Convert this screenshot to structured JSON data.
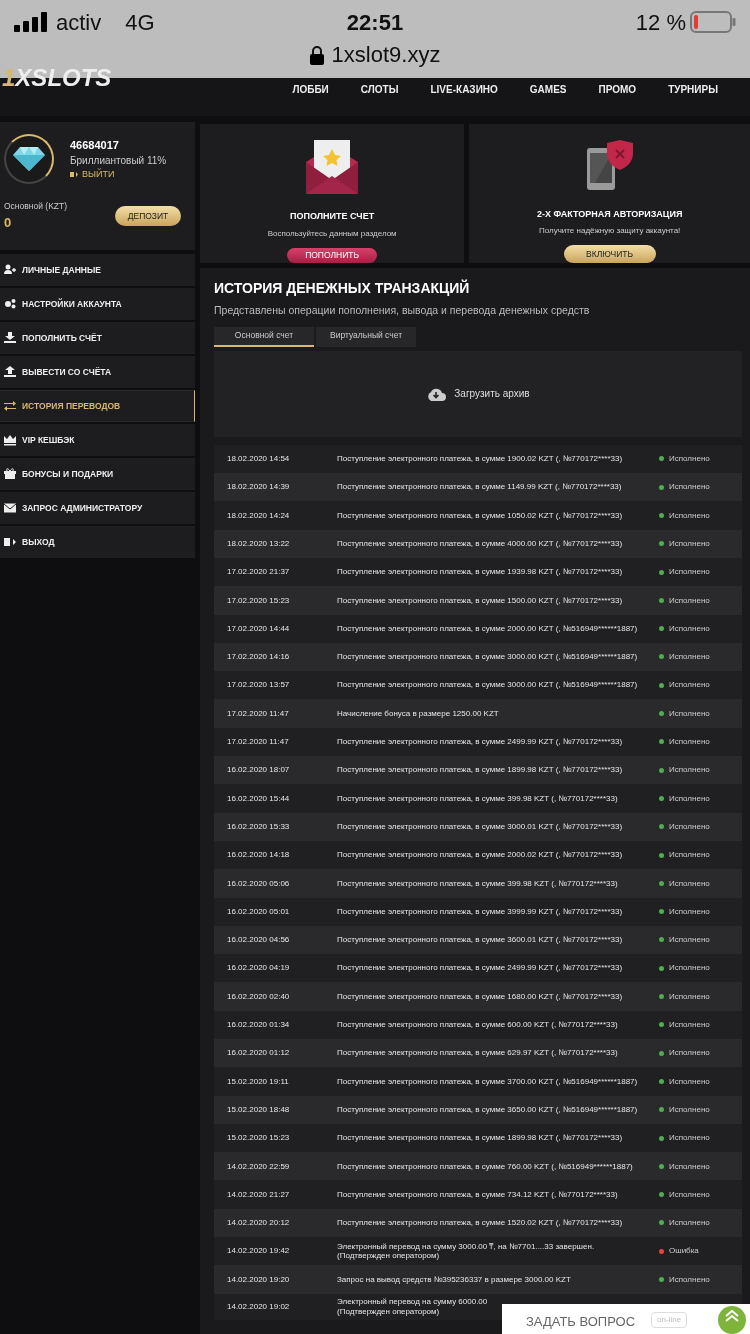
{
  "status_bar": {
    "carrier": "activ",
    "network": "4G",
    "time": "22:51",
    "battery": "12 %",
    "url": "1xslot9.xyz"
  },
  "header": {
    "logo": "1XSLOTS",
    "nav": [
      "ЛОББИ",
      "СЛОТЫ",
      "LIVE-КАЗИНО",
      "GAMES",
      "ПРОМО",
      "ТУРНИРЫ"
    ]
  },
  "profile": {
    "account_id": "46684017",
    "level": "Бриллиантовый 11%",
    "logout": "ВЫЙТИ",
    "balance_label": "Основной (KZT)",
    "balance": "0",
    "deposit_button": "ДЕПОЗИТ"
  },
  "sidebar": {
    "items": [
      {
        "label": "ЛИЧНЫЕ ДАННЫЕ",
        "selected": false
      },
      {
        "label": "НАСТРОЙКИ АККАУНТА",
        "selected": false
      },
      {
        "label": "ПОПОЛНИТЬ СЧЁТ",
        "selected": false
      },
      {
        "label": "ВЫВЕСТИ СО СЧЁТА",
        "selected": false
      },
      {
        "label": "ИСТОРИЯ ПЕРЕВОДОВ",
        "selected": true
      },
      {
        "label": "VIP КЕШБЭК",
        "selected": false
      },
      {
        "label": "БОНУСЫ И ПОДАРКИ",
        "selected": false
      },
      {
        "label": "ЗАПРОС АДМИНИСТРАТОРУ",
        "selected": false
      },
      {
        "label": "ВЫХОД",
        "selected": false
      }
    ]
  },
  "promo_cards": [
    {
      "kind": "envelope",
      "title": "ПОПОЛНИТЕ СЧЕТ",
      "text": "Воспользуйтесь данным разделом",
      "button": "ПОПОЛНИТЬ"
    },
    {
      "kind": "phone",
      "title": "2-Х ФАКТОРНАЯ АВТОРИЗАЦИЯ",
      "text": "Получите надёжную защиту аккаунта!",
      "button": "ВКЛЮЧИТЬ"
    }
  ],
  "history": {
    "title": "ИСТОРИЯ ДЕНЕЖНЫХ ТРАНЗАКЦИЙ",
    "subtitle": "Представлены операции пополнения, вывода и перевода денежных средств",
    "tabs": [
      {
        "label": "Основной счет",
        "selected": true
      },
      {
        "label": "Виртуальный счет",
        "selected": false
      }
    ],
    "archive_button": "Загрузить архив",
    "rows": [
      {
        "date": "18.02.2020 14:54",
        "text": "Поступление электронного платежа, в сумме 1900.02 KZT (, №770172****33)",
        "status": "Исполнено",
        "color": "#4caf50"
      },
      {
        "date": "18.02.2020 14:39",
        "text": "Поступление электронного платежа, в сумме 1149.99 KZT (, №770172****33)",
        "status": "Исполнено",
        "color": "#4caf50"
      },
      {
        "date": "18.02.2020 14:24",
        "text": "Поступление электронного платежа, в сумме 1050.02 KZT (, №770172****33)",
        "status": "Исполнено",
        "color": "#4caf50"
      },
      {
        "date": "18.02.2020 13:22",
        "text": "Поступление электронного платежа, в сумме 4000.00 KZT (, №770172****33)",
        "status": "Исполнено",
        "color": "#4caf50"
      },
      {
        "date": "17.02.2020 21:37",
        "text": "Поступление электронного платежа, в сумме 1939.98 KZT (, №770172****33)",
        "status": "Исполнено",
        "color": "#4caf50"
      },
      {
        "date": "17.02.2020 15:23",
        "text": "Поступление электронного платежа, в сумме 1500.00 KZT (, №770172****33)",
        "status": "Исполнено",
        "color": "#4caf50"
      },
      {
        "date": "17.02.2020 14:44",
        "text": "Поступление электронного платежа, в сумме 2000.00 KZT (, №516949******1887)",
        "status": "Исполнено",
        "color": "#4caf50"
      },
      {
        "date": "17.02.2020 14:16",
        "text": "Поступление электронного платежа, в сумме 3000.00 KZT (, №516949******1887)",
        "status": "Исполнено",
        "color": "#4caf50"
      },
      {
        "date": "17.02.2020 13:57",
        "text": "Поступление электронного платежа, в сумме 3000.00 KZT (, №516949******1887)",
        "status": "Исполнено",
        "color": "#4caf50"
      },
      {
        "date": "17.02.2020 11:47",
        "text": "Начисление бонуса в размере 1250.00 KZT",
        "status": "Исполнено",
        "color": "#4caf50"
      },
      {
        "date": "17.02.2020 11:47",
        "text": "Поступление электронного платежа, в сумме 2499.99 KZT (, №770172****33)",
        "status": "Исполнено",
        "color": "#4caf50"
      },
      {
        "date": "16.02.2020 18:07",
        "text": "Поступление электронного платежа, в сумме 1899.98 KZT (, №770172****33)",
        "status": "Исполнено",
        "color": "#4caf50"
      },
      {
        "date": "16.02.2020 15:44",
        "text": "Поступление электронного платежа, в сумме 399.98 KZT (, №770172****33)",
        "status": "Исполнено",
        "color": "#4caf50"
      },
      {
        "date": "16.02.2020 15:33",
        "text": "Поступление электронного платежа, в сумме 3000.01 KZT (, №770172****33)",
        "status": "Исполнено",
        "color": "#4caf50"
      },
      {
        "date": "16.02.2020 14:18",
        "text": "Поступление электронного платежа, в сумме 2000.02 KZT (, №770172****33)",
        "status": "Исполнено",
        "color": "#4caf50"
      },
      {
        "date": "16.02.2020 05:06",
        "text": "Поступление электронного платежа, в сумме 399.98 KZT (, №770172****33)",
        "status": "Исполнено",
        "color": "#4caf50"
      },
      {
        "date": "16.02.2020 05:01",
        "text": "Поступление электронного платежа, в сумме 3999.99 KZT (, №770172****33)",
        "status": "Исполнено",
        "color": "#4caf50"
      },
      {
        "date": "16.02.2020 04:56",
        "text": "Поступление электронного платежа, в сумме 3600.01 KZT (, №770172****33)",
        "status": "Исполнено",
        "color": "#4caf50"
      },
      {
        "date": "16.02.2020 04:19",
        "text": "Поступление электронного платежа, в сумме 2499.99 KZT (, №770172****33)",
        "status": "Исполнено",
        "color": "#4caf50"
      },
      {
        "date": "16.02.2020 02:40",
        "text": "Поступление электронного платежа, в сумме 1680.00 KZT (, №770172****33)",
        "status": "Исполнено",
        "color": "#4caf50"
      },
      {
        "date": "16.02.2020 01:34",
        "text": "Поступление электронного платежа, в сумме 600.00 KZT (, №770172****33)",
        "status": "Исполнено",
        "color": "#4caf50"
      },
      {
        "date": "16.02.2020 01:12",
        "text": "Поступление электронного платежа, в сумме 629.97 KZT (, №770172****33)",
        "status": "Исполнено",
        "color": "#4caf50"
      },
      {
        "date": "15.02.2020 19:11",
        "text": "Поступление электронного платежа, в сумме 3700.00 KZT (, №516949******1887)",
        "status": "Исполнено",
        "color": "#4caf50"
      },
      {
        "date": "15.02.2020 18:48",
        "text": "Поступление электронного платежа, в сумме 3650.00 KZT (, №516949******1887)",
        "status": "Исполнено",
        "color": "#4caf50"
      },
      {
        "date": "15.02.2020 15:23",
        "text": "Поступление электронного платежа, в сумме 1899.98 KZT (, №770172****33)",
        "status": "Исполнено",
        "color": "#4caf50"
      },
      {
        "date": "14.02.2020 22:59",
        "text": "Поступление электронного платежа, в сумме 760.00 KZT (, №516949******1887)",
        "status": "Исполнено",
        "color": "#4caf50"
      },
      {
        "date": "14.02.2020 21:27",
        "text": "Поступление электронного платежа, в сумме 734.12 KZT (, №770172****33)",
        "status": "Исполнено",
        "color": "#4caf50"
      },
      {
        "date": "14.02.2020 20:12",
        "text": "Поступление электронного платежа, в сумме 1520.02 KZT (, №770172****33)",
        "status": "Исполнено",
        "color": "#4caf50"
      },
      {
        "date": "14.02.2020 19:42",
        "text": "Электронный перевод на сумму 3000.00 ₸, на №7701....33 завершен. (Подтвержден оператором)",
        "status": "Ошибка",
        "color": "#e0483e"
      },
      {
        "date": "14.02.2020 19:20",
        "text": "Запрос на вывод средств №395236337 в размере 3000.00 KZT",
        "status": "Исполнено",
        "color": "#4caf50"
      },
      {
        "date": "14.02.2020 19:02",
        "text": "Электронный перевод на сумму 6000.00 (Подтвержден оператором)"
      }
    ]
  },
  "chat_widget": {
    "label": "ЗАДАТЬ ВОПРОС",
    "badge": "on-line"
  }
}
